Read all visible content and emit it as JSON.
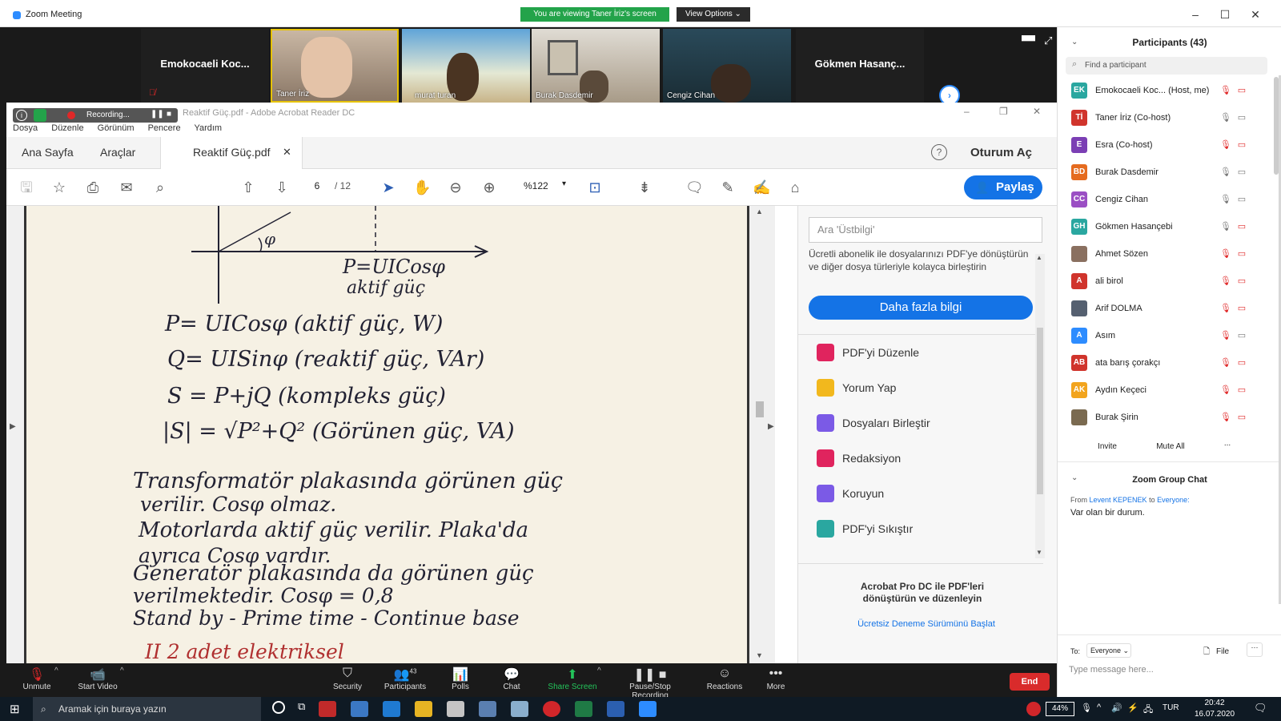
{
  "zoom": {
    "window_title": "Zoom Meeting",
    "viewing_banner": "You are viewing Taner İriz's screen",
    "view_options": "View Options"
  },
  "video_tiles": [
    {
      "name": "Emokocaeli Koc...",
      "type": "name-only"
    },
    {
      "name": "Taner İriz",
      "type": "video"
    },
    {
      "name": "murat turan",
      "type": "video"
    },
    {
      "name": "Burak Dasdemir",
      "type": "video"
    },
    {
      "name": "Cengiz Cihan",
      "type": "video"
    },
    {
      "name": "Gökmen Hasanç...",
      "type": "name-only"
    }
  ],
  "acrobat": {
    "window_title": "Reaktif Güç.pdf - Adobe Acrobat Reader DC",
    "recording_label": "Recording...",
    "menu": [
      "Dosya",
      "Düzenle",
      "Görünüm",
      "Pencere",
      "Yardım"
    ],
    "tabs": {
      "home": "Ana Sayfa",
      "tools": "Araçlar",
      "document": "Reaktif Güç.pdf"
    },
    "sign_in": "Oturum Aç",
    "share_button": "Paylaş",
    "page_current": "6",
    "page_total": "/ 12",
    "zoom_level": "%122",
    "search_placeholder": "Ara 'Üstbilgi'",
    "promo_text": "Ücretli abonelik ile dosyalarınızı PDF'ye dönüştürün ve diğer dosya türleriyle kolayca birleştirin",
    "more_info_button": "Daha fazla bilgi",
    "tools_list": [
      {
        "label": "PDF'yi Düzenle",
        "icon": "edit-pdf-icon",
        "color": "#e0245e"
      },
      {
        "label": "Yorum Yap",
        "icon": "comment-icon",
        "color": "#f2b81d"
      },
      {
        "label": "Dosyaları Birleştir",
        "icon": "combine-files-icon",
        "color": "#7b5ae6"
      },
      {
        "label": "Redaksiyon",
        "icon": "redact-icon",
        "color": "#e0245e"
      },
      {
        "label": "Koruyun",
        "icon": "protect-icon",
        "color": "#7b5ae6"
      },
      {
        "label": "PDF'yi Sıkıştır",
        "icon": "compress-pdf-icon",
        "color": "#2aa7a0"
      }
    ],
    "pro_promo_title": "Acrobat Pro DC ile PDF'leri dönüştürün ve düzenleyin",
    "trial_link": "Ücretsiz Deneme Sürümünü Başlat"
  },
  "handwriting": {
    "formula_top": "P=UICosφ",
    "formula_top_sub": "aktif güç",
    "line1": "P= UICosφ  (aktif güç, W)",
    "line2": "Q= UISinφ  (reaktif güç, VAr)",
    "line3": "S = P+jQ   (kompleks güç)",
    "line4": "|S| = √P²+Q²   (Görünen güç, VA)",
    "para1": "Transformatör   plakasında   görünen güç",
    "para2": "verilir. Cosφ  olmaz.",
    "para3": "Motorlarda  aktif güç  verilir. Plaka'da",
    "para4": "ayrıca  Cosφ  vardır.",
    "para5": "Generatör plakasında da  görünen güç",
    "para6": "verilmektedir. Cosφ = 0,8",
    "para7": "Stand by - Prime  time - Continue  base",
    "para8": "II        2 adet  elektriksel"
  },
  "zoom_toolbar": {
    "unmute": "Unmute",
    "start_video": "Start Video",
    "security": "Security",
    "participants": "Participants",
    "participants_count": "43",
    "polls": "Polls",
    "chat": "Chat",
    "share_screen": "Share Screen",
    "pause_stop": "Pause/Stop Recording",
    "reactions": "Reactions",
    "more": "More",
    "end": "End"
  },
  "participants_panel": {
    "title": "Participants (43)",
    "find_placeholder": "Find a participant",
    "list": [
      {
        "initials": "EK",
        "name": "Emokocaeli Koc...  (Host, me)",
        "color": "#2aa7a0"
      },
      {
        "initials": "Tİ",
        "name": "Taner İriz (Co-host)",
        "color": "#d0342c"
      },
      {
        "initials": "E",
        "name": "Esra  (Co-host)",
        "color": "#7b3fb4"
      },
      {
        "initials": "BD",
        "name": "Burak Dasdemir",
        "color": "#e56b1f"
      },
      {
        "initials": "CC",
        "name": "Cengiz Cihan",
        "color": "#9b4fc4"
      },
      {
        "initials": "GH",
        "name": "Gökmen Hasançebi",
        "color": "#2aa7a0"
      },
      {
        "initials": "",
        "name": "Ahmet Sözen",
        "color": "#8a7060"
      },
      {
        "initials": "A",
        "name": "ali birol",
        "color": "#d0342c"
      },
      {
        "initials": "",
        "name": "Arif DOLMA",
        "color": "#556070"
      },
      {
        "initials": "A",
        "name": "Asım",
        "color": "#2d8cff"
      },
      {
        "initials": "AB",
        "name": "ata barış çorakçı",
        "color": "#d0342c"
      },
      {
        "initials": "AK",
        "name": "Aydın Keçeci",
        "color": "#f2a41d"
      },
      {
        "initials": "",
        "name": "Burak Şirin",
        "color": "#7a6a50"
      }
    ],
    "invite": "Invite",
    "mute_all": "Mute All",
    "more": "...",
    "chat_title": "Zoom Group Chat",
    "chat_from_prefix": "From",
    "chat_from": "Levent KEPENEK",
    "chat_to_word": "to",
    "chat_to": "Everyone:",
    "chat_message": "Var olan bir durum.",
    "to_label": "To:",
    "to_value": "Everyone",
    "file_label": "File",
    "message_placeholder": "Type message here..."
  },
  "taskbar": {
    "search_placeholder": "Aramak için buraya yazın",
    "battery": "44%",
    "language": "TUR",
    "time": "20:42",
    "date": "16.07.2020"
  }
}
